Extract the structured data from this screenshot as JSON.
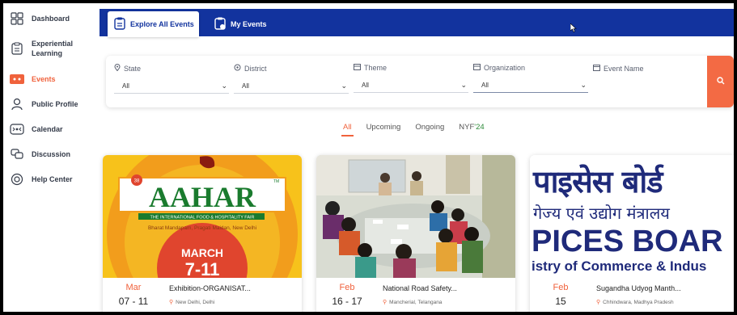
{
  "sidebar": {
    "items": [
      {
        "label": "Dashboard",
        "icon": "dashboard-icon"
      },
      {
        "label": "Experiential Learning",
        "icon": "clipboard-icon"
      },
      {
        "label": "Events",
        "icon": "events-icon"
      },
      {
        "label": "Public Profile",
        "icon": "user-icon"
      },
      {
        "label": "Calendar",
        "icon": "calendar-icon"
      },
      {
        "label": "Discussion",
        "icon": "chat-icon"
      },
      {
        "label": "Help Center",
        "icon": "help-icon"
      }
    ],
    "active": "Events"
  },
  "topnav": {
    "tabs": [
      {
        "label": "Explore All Events",
        "icon": "clipboard-list-icon"
      },
      {
        "label": "My Events",
        "icon": "clipboard-user-icon"
      }
    ]
  },
  "filters": {
    "state": {
      "label": "State",
      "value": "All",
      "icon": "location-icon"
    },
    "district": {
      "label": "District",
      "value": "All",
      "icon": "target-icon"
    },
    "theme": {
      "label": "Theme",
      "value": "All",
      "icon": "box-icon"
    },
    "organization": {
      "label": "Organization",
      "value": "All",
      "icon": "box-icon"
    },
    "event_name": {
      "label": "Event Name",
      "value": "",
      "icon": "calendar-icon"
    }
  },
  "status_tabs": [
    "All",
    "Upcoming",
    "Ongoing",
    "NYF",
    "'24"
  ],
  "cards": [
    {
      "month": "Mar",
      "days": "07 - 11",
      "title": "Exhibition-ORGANISAT...",
      "location": "New Delhi, Delhi",
      "poster": {
        "number": "38",
        "headline": "AAHAR",
        "tm": "TM",
        "subtitle": "THE INTERNATIONAL FOOD & HOSPITALITY FAIR",
        "venue": "Bharat Mandapam, Pragati Maidan, New Delhi",
        "month": "MARCH",
        "days": "7-11"
      }
    },
    {
      "month": "Feb",
      "days": "16 - 17",
      "title": "National Road Safety...",
      "location": "Mancherial, Telangana"
    },
    {
      "month": "Feb",
      "days": "15",
      "title": "Sugandha Udyog Manth...",
      "location": "Chhindwara, Madhya Pradesh",
      "poster": {
        "line1": "पाइसेस बोर्ड",
        "line2": "गेज्य एवं उद्योग मंत्रालय",
        "line3": "PICES BOAR",
        "line4": "istry of Commerce & Indus"
      }
    }
  ],
  "colors": {
    "primary": "#12339e",
    "accent": "#f0623c",
    "search": "#f36a44"
  }
}
